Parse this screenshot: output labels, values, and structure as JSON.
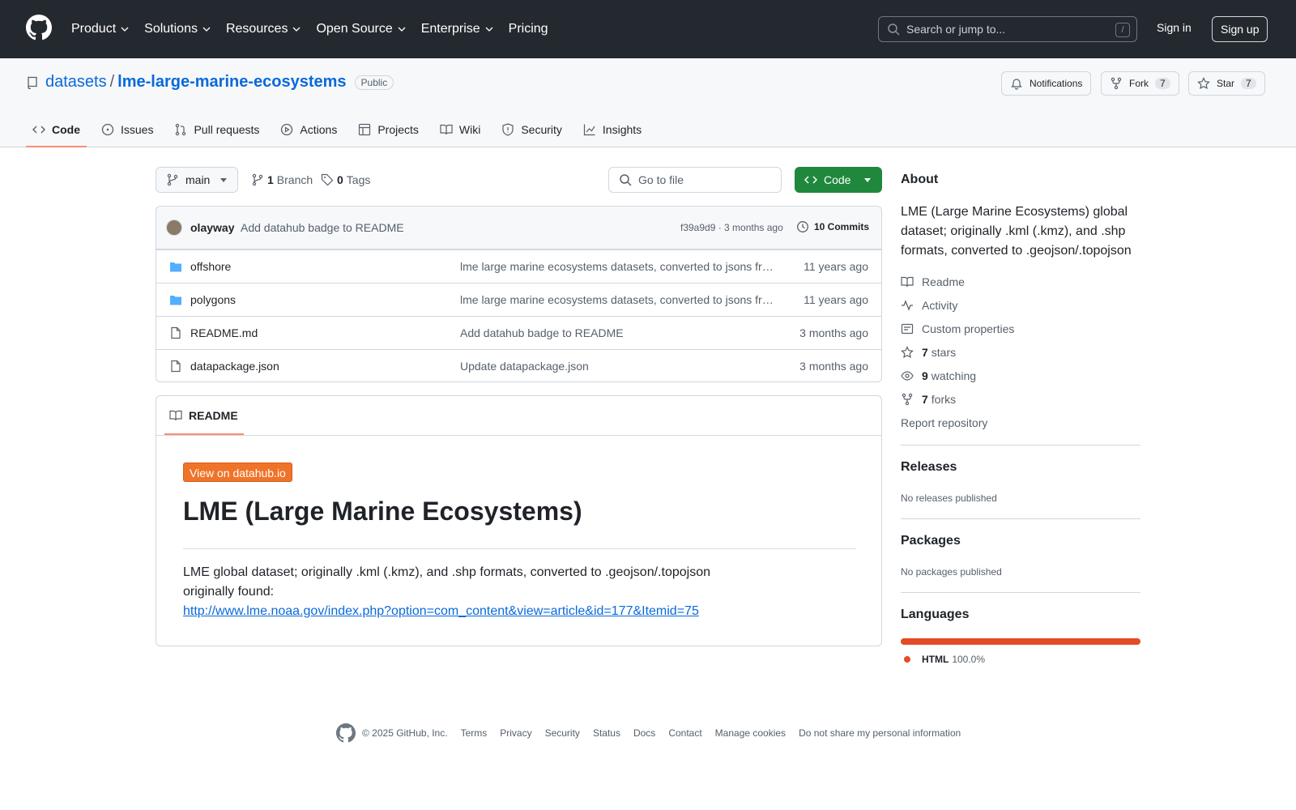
{
  "header": {
    "nav": [
      "Product",
      "Solutions",
      "Resources",
      "Open Source",
      "Enterprise",
      "Pricing"
    ],
    "search_placeholder": "Search or jump to...",
    "search_key": "/",
    "signin": "Sign in",
    "signup": "Sign up"
  },
  "repo": {
    "owner": "datasets",
    "sep": "/",
    "name": "lme-large-marine-ecosystems",
    "visibility": "Public",
    "notifications": "Notifications",
    "fork_label": "Fork",
    "fork_count": "7",
    "star_label": "Star",
    "star_count": "7"
  },
  "tabs": [
    "Code",
    "Issues",
    "Pull requests",
    "Actions",
    "Projects",
    "Wiki",
    "Security",
    "Insights"
  ],
  "branch": {
    "name": "main",
    "branch_count": "1",
    "branch_label": "Branch",
    "tag_count": "0",
    "tag_label": "Tags",
    "go_to_file": "Go to file",
    "code_button": "Code"
  },
  "commit": {
    "user": "olayway",
    "message": "Add datahub badge to README",
    "hash_time": "f39a9d9 · 3 months ago",
    "count_label": "10 Commits"
  },
  "files": [
    {
      "name": "offshore",
      "type": "dir",
      "message": "lme large marine ecosystems datasets, converted to jsons from kml files",
      "time": "11 years ago"
    },
    {
      "name": "polygons",
      "type": "dir",
      "message": "lme large marine ecosystems datasets, converted to jsons from kml files",
      "time": "11 years ago"
    },
    {
      "name": "README.md",
      "type": "file",
      "message": "Add datahub badge to README",
      "time": "3 months ago"
    },
    {
      "name": "datapackage.json",
      "type": "file",
      "message": "Update datapackage.json",
      "time": "3 months ago"
    }
  ],
  "readme": {
    "tab": "README",
    "badge": "View on datahub.io",
    "title": "LME (Large Marine Ecosystems)",
    "line1": "LME global dataset; originally .kml (.kmz), and .shp formats, converted to .geojson/.topojson",
    "line2": "originally found:",
    "link": "http://www.lme.noaa.gov/index.php?option=com_content&view=article&id=177&Itemid=75"
  },
  "sidebar": {
    "about_title": "About",
    "about_text": "LME (Large Marine Ecosystems) global dataset; originally .kml (.kmz), and .shp formats, converted to .geojson/.topojson",
    "readme": "Readme",
    "activity": "Activity",
    "custom_properties": "Custom properties",
    "stars_count": "7",
    "stars_label": "stars",
    "watching_count": "9",
    "watching_label": "watching",
    "forks_count": "7",
    "forks_label": "forks",
    "report": "Report repository",
    "releases_title": "Releases",
    "releases_text": "No releases published",
    "packages_title": "Packages",
    "packages_text": "No packages published",
    "languages_title": "Languages",
    "lang_name": "HTML",
    "lang_pct": "100.0%",
    "lang_color": "#e34c26"
  },
  "footer": [
    "© 2025 GitHub, Inc.",
    "Terms",
    "Privacy",
    "Security",
    "Status",
    "Docs",
    "Contact",
    "Manage cookies",
    "Do not share my personal information"
  ]
}
